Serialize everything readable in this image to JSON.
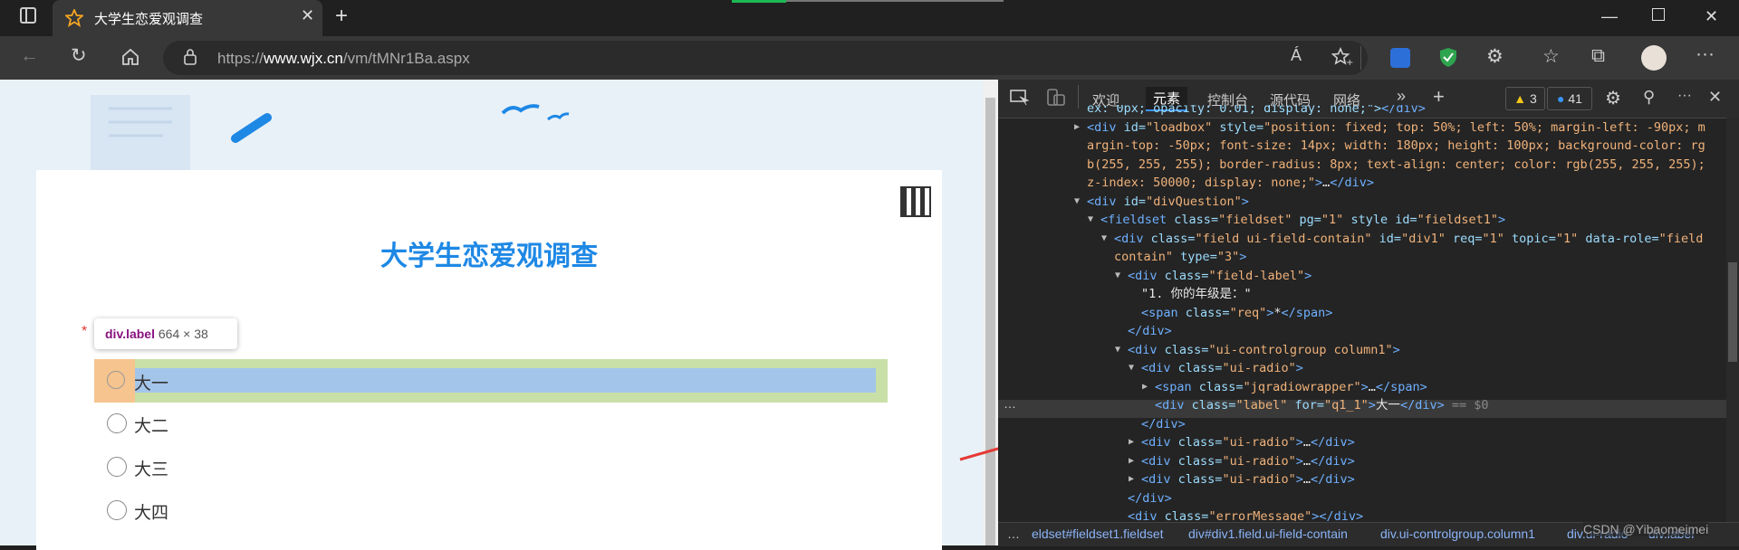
{
  "browser": {
    "tab_title": "大学生恋爱观调查",
    "url_prefix": "https://",
    "url_domain": "www.wjx.cn",
    "url_path": "/vm/tMNr1Ba.aspx",
    "read_aloud": "Á"
  },
  "survey": {
    "title": "大学生恋爱观调查",
    "required_mark": "*",
    "tooltip_tag": "div.label",
    "tooltip_size": "664 × 38",
    "options": [
      "大一",
      "大二",
      "大三",
      "大四"
    ]
  },
  "devtools": {
    "tabs": [
      "欢迎",
      "元素",
      "控制台",
      "源代码",
      "网络"
    ],
    "warnings": "3",
    "messages": "41",
    "lines": [
      {
        "indent": 6,
        "arrow": "",
        "html": "<span class='an'>ex: 0px; opacity: 0.01; display: none;\"></span><span class='tag'>&lt;/div&gt;</span>"
      },
      {
        "indent": 6,
        "arrow": "▶",
        "html": "<span class='tag'>&lt;div</span> <span class='an'>id</span>=<span class='av'>\"loadbox\"</span> <span class='an'>style</span>=<span class='av'>\"position: fixed; top: 50%; left: 50%; margin-left: -90px; m</span>"
      },
      {
        "indent": 6,
        "arrow": "",
        "html": "<span class='av'>argin-top: -50px; font-size: 14px; width: 180px; height: 100px; background-color: rg</span>"
      },
      {
        "indent": 6,
        "arrow": "",
        "html": "<span class='av'>b(255, 255, 255); border-radius: 8px; text-align: center; color: rgb(255, 255, 255);</span>"
      },
      {
        "indent": 6,
        "arrow": "",
        "html": "<span class='av'>z-index: 50000; display: none;\"</span><span class='tag'>&gt;</span><span class='tx'>…</span><span class='tag'>&lt;/div&gt;</span>"
      },
      {
        "indent": 6,
        "arrow": "▼",
        "html": "<span class='tag'>&lt;div</span> <span class='an'>id</span>=<span class='av'>\"divQuestion\"</span><span class='tag'>&gt;</span>"
      },
      {
        "indent": 7,
        "arrow": "▼",
        "html": "<span class='tag'>&lt;fieldset</span> <span class='an'>class</span>=<span class='av'>\"fieldset\"</span> <span class='an'>pg</span>=<span class='av'>\"1\"</span> <span class='an'>style id</span>=<span class='av'>\"fieldset1\"</span><span class='tag'>&gt;</span>"
      },
      {
        "indent": 8,
        "arrow": "▼",
        "html": "<span class='tag'>&lt;div</span> <span class='an'>class</span>=<span class='av'>\"field ui-field-contain\"</span> <span class='an'>id</span>=<span class='av'>\"div1\"</span> <span class='an'>req</span>=<span class='av'>\"1\"</span> <span class='an'>topic</span>=<span class='av'>\"1\"</span> <span class='an'>data-role</span>=<span class='av'>\"field</span>"
      },
      {
        "indent": 8,
        "arrow": "",
        "html": "<span class='av'>contain\"</span> <span class='an'>type</span>=<span class='av'>\"3\"</span><span class='tag'>&gt;</span>"
      },
      {
        "indent": 9,
        "arrow": "▼",
        "html": "<span class='tag'>&lt;div</span> <span class='an'>class</span>=<span class='av'>\"field-label\"</span><span class='tag'>&gt;</span>"
      },
      {
        "indent": 10,
        "arrow": "",
        "html": "<span class='tx'>\"1. 你的年级是：\"</span>"
      },
      {
        "indent": 10,
        "arrow": "",
        "html": "<span class='tag'>&lt;span</span> <span class='an'>class</span>=<span class='av'>\"req\"</span><span class='tag'>&gt;</span><span class='tx'>*</span><span class='tag'>&lt;/span&gt;</span>"
      },
      {
        "indent": 9,
        "arrow": "",
        "html": "<span class='tag'>&lt;/div&gt;</span>"
      },
      {
        "indent": 9,
        "arrow": "▼",
        "html": "<span class='tag'>&lt;div</span> <span class='an'>class</span>=<span class='av'>\"ui-controlgroup column1\"</span><span class='tag'>&gt;</span>"
      },
      {
        "indent": 10,
        "arrow": "▼",
        "html": "<span class='tag'>&lt;div</span> <span class='an'>class</span>=<span class='av'>\"ui-radio\"</span><span class='tag'>&gt;</span>"
      },
      {
        "indent": 11,
        "arrow": "▶",
        "html": "<span class='tag'>&lt;span</span> <span class='an'>class</span>=<span class='av'>\"jqradiowrapper\"</span><span class='tag'>&gt;</span><span class='tx'>…</span><span class='tag'>&lt;/span&gt;</span>"
      },
      {
        "indent": 11,
        "arrow": "",
        "html": "<span class='tag'>&lt;div</span> <span class='an'>class</span>=<span class='av'>\"label\"</span> <span class='an'>for</span>=<span class='av'>\"q1_1\"</span><span class='tag'>&gt;</span><span class='tx'>大一</span><span class='tag'>&lt;/div&gt;</span> <span style='color:#888'>== $0</span>"
      },
      {
        "indent": 10,
        "arrow": "",
        "html": "<span class='tag'>&lt;/div&gt;</span>"
      },
      {
        "indent": 10,
        "arrow": "▶",
        "html": "<span class='tag'>&lt;div</span> <span class='an'>class</span>=<span class='av'>\"ui-radio\"</span><span class='tag'>&gt;</span><span class='tx'>…</span><span class='tag'>&lt;/div&gt;</span>"
      },
      {
        "indent": 10,
        "arrow": "▶",
        "html": "<span class='tag'>&lt;div</span> <span class='an'>class</span>=<span class='av'>\"ui-radio\"</span><span class='tag'>&gt;</span><span class='tx'>…</span><span class='tag'>&lt;/div&gt;</span>"
      },
      {
        "indent": 10,
        "arrow": "▶",
        "html": "<span class='tag'>&lt;div</span> <span class='an'>class</span>=<span class='av'>\"ui-radio\"</span><span class='tag'>&gt;</span><span class='tx'>…</span><span class='tag'>&lt;/div&gt;</span>"
      },
      {
        "indent": 9,
        "arrow": "",
        "html": "<span class='tag'>&lt;/div&gt;</span>"
      },
      {
        "indent": 9,
        "arrow": "",
        "html": "<span class='tag'>&lt;div</span> <span class='an'>class</span>=<span class='av'>\"errorMessage\"</span><span class='tag'>&gt;&lt;/div&gt;</span>"
      }
    ],
    "breadcrumbs": [
      "…",
      "eldset#fieldset1.fieldset",
      "div#div1.field.ui-field-contain",
      "div.ui-controlgroup.column1",
      "div.ui-radio",
      "div.label"
    ],
    "watermark": "CSDN @Yibaomeimei",
    "row_dots": "…"
  }
}
